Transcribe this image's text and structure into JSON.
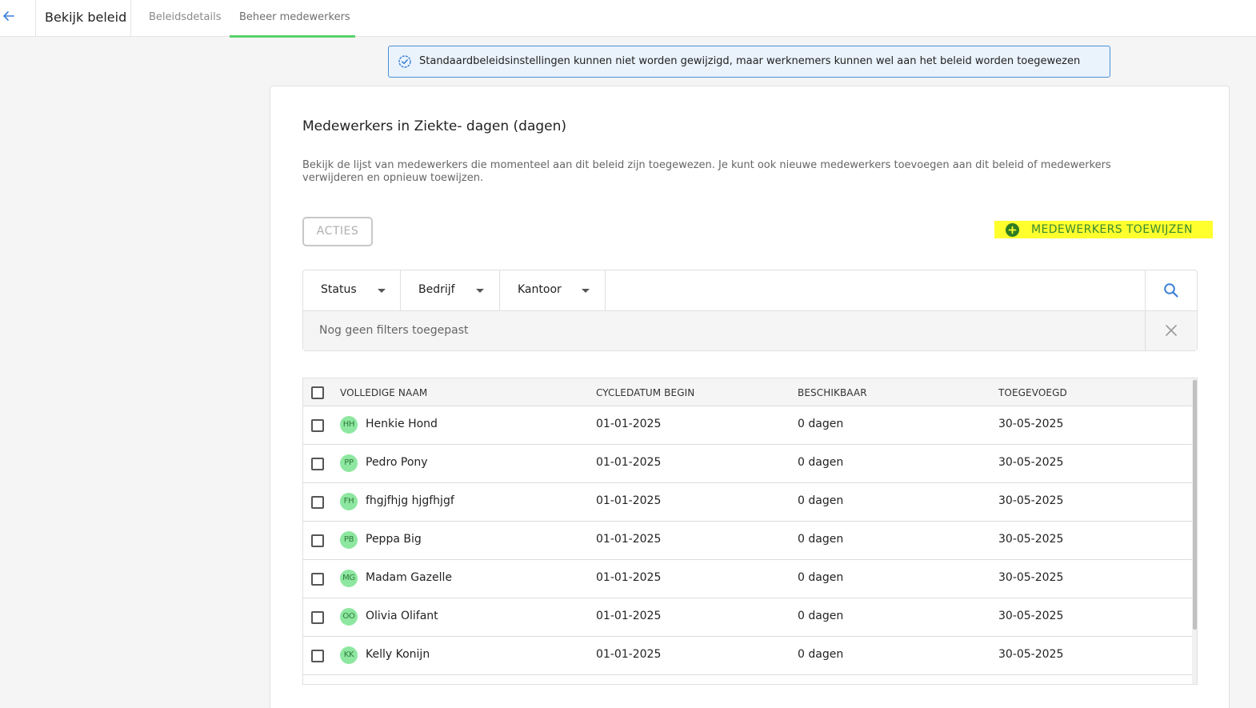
{
  "header": {
    "title": "Bekijk beleid",
    "tabs": [
      {
        "label": "Beleidsdetails",
        "active": false
      },
      {
        "label": "Beheer medewerkers",
        "active": true
      }
    ]
  },
  "banner": {
    "icon": "check-badge-icon",
    "text": "Standaardbeleidsinstellingen kunnen niet worden gewijzigd, maar werknemers kunnen wel aan het beleid worden toegewezen"
  },
  "card": {
    "title": "Medewerkers in Ziekte- dagen (dagen)",
    "description": "Bekijk de lijst van medewerkers die momenteel aan dit beleid zijn toegewezen. Je kunt ook nieuwe medewerkers toevoegen aan dit beleid of medewerkers verwijderen en opnieuw toewijzen.",
    "actions_label": "ACTIES",
    "assign_label": "MEDEWERKERS TOEWIJZEN"
  },
  "filters": {
    "dropdowns": [
      "Status",
      "Bedrijf",
      "Kantoor"
    ],
    "empty_text": "Nog geen filters toegepast"
  },
  "table": {
    "columns": [
      "VOLLEDIGE NAAM",
      "CYCLEDATUM BEGIN",
      "BESCHIKBAAR",
      "TOEGEVOEGD"
    ],
    "rows": [
      {
        "initials": "HH",
        "name": "Henkie Hond",
        "cycle_start": "01-01-2025",
        "available": "0 dagen",
        "added": "30-05-2025"
      },
      {
        "initials": "PP",
        "name": "Pedro Pony",
        "cycle_start": "01-01-2025",
        "available": "0 dagen",
        "added": "30-05-2025"
      },
      {
        "initials": "FH",
        "name": "fhgjfhjg hjgfhjgf",
        "cycle_start": "01-01-2025",
        "available": "0 dagen",
        "added": "30-05-2025"
      },
      {
        "initials": "PB",
        "name": "Peppa Big",
        "cycle_start": "01-01-2025",
        "available": "0 dagen",
        "added": "30-05-2025"
      },
      {
        "initials": "MG",
        "name": "Madam Gazelle",
        "cycle_start": "01-01-2025",
        "available": "0 dagen",
        "added": "30-05-2025"
      },
      {
        "initials": "OO",
        "name": "Olivia Olifant",
        "cycle_start": "01-01-2025",
        "available": "0 dagen",
        "added": "30-05-2025"
      },
      {
        "initials": "KK",
        "name": "Kelly Konijn",
        "cycle_start": "01-01-2025",
        "available": "0 dagen",
        "added": "30-05-2025"
      }
    ]
  },
  "colors": {
    "accent_green": "#5ad16b",
    "info_blue": "#4a90d9",
    "highlight_yellow": "#ffff2e",
    "avatar_green": "#8de7a0"
  }
}
